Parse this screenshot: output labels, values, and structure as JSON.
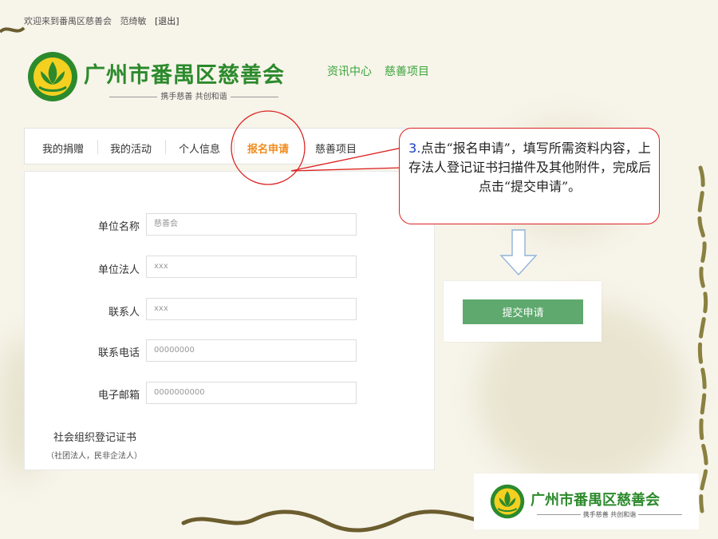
{
  "header": {
    "welcome_text": "欢迎来到番禺区慈善会",
    "user_name": "范绮敏",
    "logout_label": "[退出]",
    "site_name": "广州市番禺区慈善会",
    "slogan": "携手慈善 共创和谐",
    "nav": [
      "资讯中心",
      "慈善项目"
    ]
  },
  "tabs": [
    {
      "label": "我的捐赠"
    },
    {
      "label": "我的活动"
    },
    {
      "label": "个人信息"
    },
    {
      "label": "报名申请"
    },
    {
      "label": "慈善项目"
    }
  ],
  "form": {
    "fields": [
      {
        "label": "单位名称",
        "placeholder": "慈善会"
      },
      {
        "label": "单位法人",
        "placeholder": "xxx"
      },
      {
        "label": "联系人",
        "placeholder": "xxx"
      },
      {
        "label": "联系电话",
        "placeholder": "00000000"
      },
      {
        "label": "电子邮箱",
        "placeholder": "0000000000"
      }
    ],
    "org_cert_label": "社会组织登记证书",
    "org_cert_sub": "（社团法人，民非企法人）"
  },
  "submit_label": "提交申请",
  "callout": {
    "number": "3.",
    "text": "点击“报名申请”，填写所需资料内容，上存法人登记证书扫描件及其他附件，完成后点击“提交申请”。"
  },
  "footer": {
    "site_name": "广州市番禺区慈善会",
    "slogan": "携手慈善 共创和谐"
  },
  "colors": {
    "brand_green": "#2c8a2c",
    "active_tab": "#f08c1e",
    "submit_button": "#5fa96e",
    "callout_border": "#dd2222"
  }
}
